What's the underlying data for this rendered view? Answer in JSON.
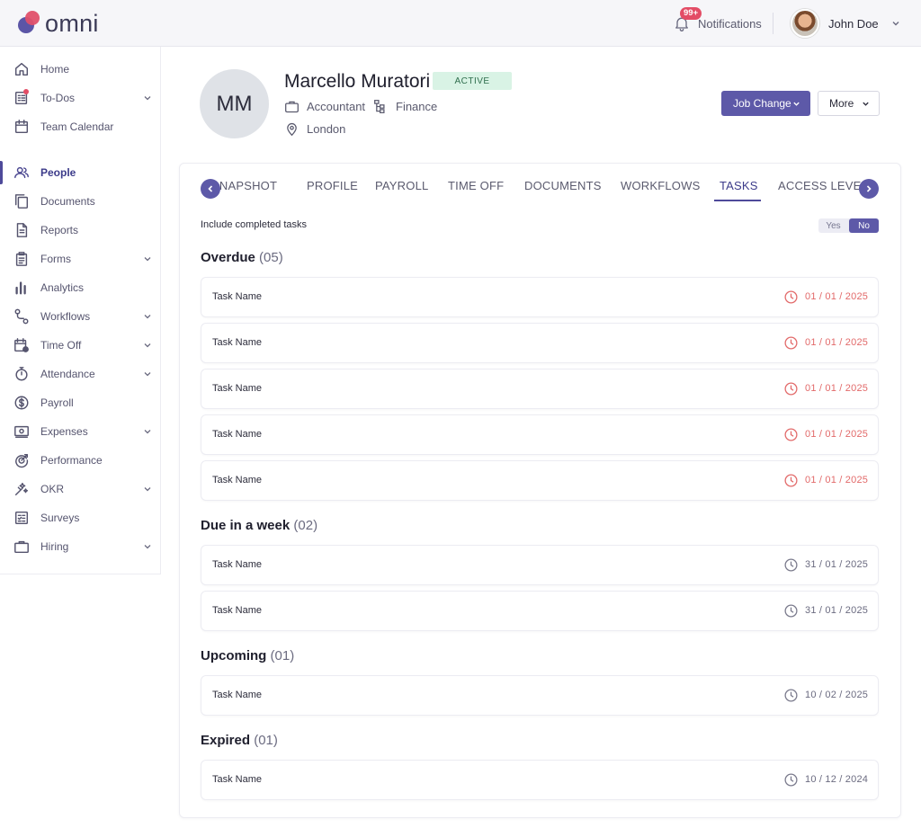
{
  "app": {
    "logo_text": "omni"
  },
  "header": {
    "notifications_badge": "99+",
    "notifications_label": "Notifications",
    "user_name": "John Doe"
  },
  "sidebar": {
    "items": [
      {
        "label": "Home",
        "icon": "home-icon"
      },
      {
        "label": "To-Dos",
        "icon": "todos-icon"
      },
      {
        "label": "Team Calendar",
        "icon": "calendar-icon"
      },
      {
        "label": "People",
        "icon": "people-icon"
      },
      {
        "label": "Documents",
        "icon": "documents-icon"
      },
      {
        "label": "Reports",
        "icon": "reports-icon"
      },
      {
        "label": "Forms",
        "icon": "forms-icon"
      },
      {
        "label": "Analytics",
        "icon": "analytics-icon"
      },
      {
        "label": "Workflows",
        "icon": "workflows-icon"
      },
      {
        "label": "Time Off",
        "icon": "time-off-icon"
      },
      {
        "label": "Attendance",
        "icon": "stopwatch-icon"
      },
      {
        "label": "Payroll",
        "icon": "dollar-icon"
      },
      {
        "label": "Expenses",
        "icon": "expenses-icon"
      },
      {
        "label": "Performance",
        "icon": "performance-icon"
      },
      {
        "label": "OKR",
        "icon": "okr-icon"
      },
      {
        "label": "Surveys",
        "icon": "surveys-icon"
      },
      {
        "label": "Hiring",
        "icon": "briefcase-icon"
      }
    ]
  },
  "profile": {
    "initials": "MM",
    "name": "Marcello Muratori",
    "status": "ACTIVE",
    "role": "Accountant",
    "department": "Finance",
    "location": "London"
  },
  "actions": {
    "job_change": "Job Change",
    "more": "More"
  },
  "tabs": [
    "SNAPSHOT",
    "PROFILE",
    "PAYROLL",
    "TIME OFF",
    "DOCUMENTS",
    "WORKFLOWS",
    "TASKS",
    "ACCESS LEVEL"
  ],
  "active_tab": "TASKS",
  "filter": {
    "label": "Include completed tasks",
    "yes": "Yes",
    "no": "No",
    "selected": "No"
  },
  "sections": {
    "overdue": {
      "title": "Overdue",
      "count": "(05)",
      "tasks": [
        {
          "name": "Task Name",
          "date": "01 / 01 / 2025"
        },
        {
          "name": "Task Name",
          "date": "01 / 01 / 2025"
        },
        {
          "name": "Task Name",
          "date": "01 / 01 / 2025"
        },
        {
          "name": "Task Name",
          "date": "01 / 01 / 2025"
        },
        {
          "name": "Task Name",
          "date": "01 / 01 / 2025"
        }
      ]
    },
    "due_week": {
      "title": "Due in a week",
      "count": "(02)",
      "tasks": [
        {
          "name": "Task Name",
          "date": "31 / 01 / 2025"
        },
        {
          "name": "Task Name",
          "date": "31 / 01 / 2025"
        }
      ]
    },
    "upcoming": {
      "title": "Upcoming",
      "count": "(01)",
      "tasks": [
        {
          "name": "Task Name",
          "date": "10 / 02 / 2025"
        }
      ]
    },
    "expired": {
      "title": "Expired",
      "count": "(01)",
      "tasks": [
        {
          "name": "Task Name",
          "date": "10 / 12 / 2024"
        }
      ]
    }
  },
  "colors": {
    "accent": "#5d59a8",
    "overdue": "#e26a6a",
    "muted": "#6b6b80",
    "active_bg": "#d9f3e5"
  }
}
